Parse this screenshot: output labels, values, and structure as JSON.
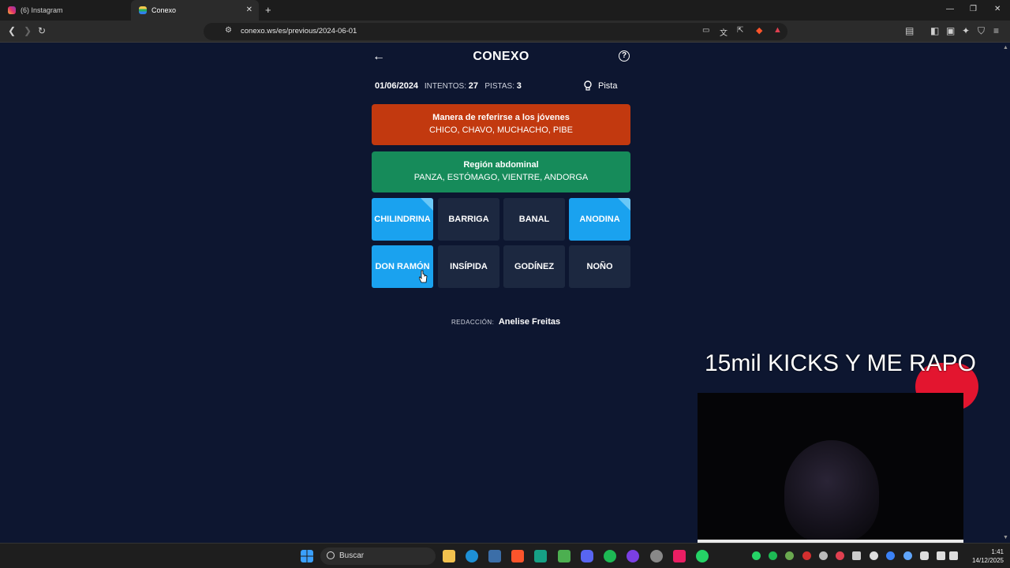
{
  "browser": {
    "tabs": [
      {
        "title": "(6) Instagram",
        "active": false,
        "icon": "instagram-icon"
      },
      {
        "title": "Conexo",
        "active": true,
        "icon": "conexo-favicon"
      }
    ],
    "url": "conexo.ws/es/previous/2024-06-01"
  },
  "game": {
    "title": "CONEXO",
    "date": "01/06/2024",
    "attempts_label": "INTENTOS:",
    "attempts": "27",
    "hints_label": "PISTAS:",
    "hints": "3",
    "hint_button": "Pista",
    "solved_groups": [
      {
        "title": "Manera de referirse a los jóvenes",
        "words": "CHICO, CHAVO, MUCHACHO, PIBE",
        "color": "#c2390f"
      },
      {
        "title": "Región abdominal",
        "words": "PANZA, ESTÓMAGO, VIENTRE, ANDORGA",
        "color": "#168b5a"
      }
    ],
    "tiles": [
      {
        "word": "CHILINDRINA",
        "selected": true,
        "hinted": true
      },
      {
        "word": "BARRIGA",
        "selected": false,
        "hinted": false
      },
      {
        "word": "BANAL",
        "selected": false,
        "hinted": false
      },
      {
        "word": "ANODINA",
        "selected": true,
        "hinted": true
      },
      {
        "word": "DON RAMÓN",
        "selected": true,
        "hinted": false
      },
      {
        "word": "INSÍPIDA",
        "selected": false,
        "hinted": false
      },
      {
        "word": "GODÍNEZ",
        "selected": false,
        "hinted": false
      },
      {
        "word": "NOÑO",
        "selected": false,
        "hinted": false
      }
    ],
    "credits_label": "REDACCIÓN:",
    "credits_name": "Anelise Freitas",
    "colors": {
      "background": "#0d1630",
      "tile": "#1c2840",
      "tile_selected": "#1aa2ef"
    }
  },
  "overlay": {
    "text": "15mil KICKS Y ME RAPO"
  },
  "taskbar": {
    "search_placeholder": "Buscar",
    "time": "1:41",
    "date": "14/12/2025"
  }
}
